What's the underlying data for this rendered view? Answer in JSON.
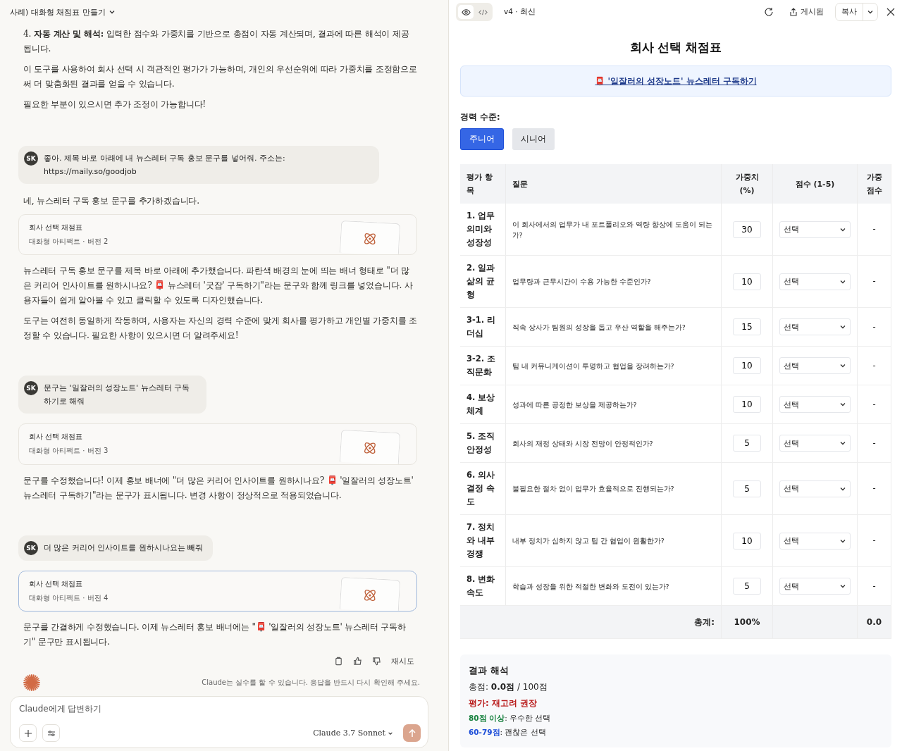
{
  "chat": {
    "title": "사례) 대화형 채점표 만들기",
    "messages": [
      {
        "kind": "assistant",
        "paragraphs": [
          "4. **자동 계산 및 해석:** 입력한 점수와 가중치를 기반으로 총점이 자동 계산되며, 결과에 따른 해석이 제공됩니다.",
          "이 도구를 사용하여 회사 선택 시 객관적인 평가가 가능하며, 개인의 우선순위에 따라 가중치를 조정함으로써 더 맞춤화된 결과를 얻을 수 있습니다.",
          "필요한 부분이 있으시면 추가 조정이 가능합니다!"
        ]
      },
      {
        "kind": "user",
        "avatar": "SK",
        "text": "좋아. 제목 바로 아래에 내 뉴스레터 구독 홍보 문구를 넣어줘. 주소는: https://maily.so/goodjob"
      },
      {
        "kind": "assistant",
        "paragraphs": [
          "네, 뉴스레터 구독 홍보 문구를 추가하겠습니다."
        ]
      },
      {
        "kind": "artifact",
        "title": "회사 선택 채점표",
        "subtitle": "대화형 아티팩트 · 버전 2",
        "selected": false
      },
      {
        "kind": "assistant",
        "paragraphs": [
          "뉴스레터 구독 홍보 문구를 제목 바로 아래에 추가했습니다. 파란색 배경의 눈에 띄는 배너 형태로 \"더 많은 커리어 인사이트를 원하시나요? 📮 뉴스레터 '굿잡' 구독하기\"라는 문구와 함께 링크를 넣었습니다. 사용자들이 쉽게 알아볼 수 있고 클릭할 수 있도록 디자인했습니다.",
          "도구는 여전히 동일하게 작동하며, 사용자는 자신의 경력 수준에 맞게 회사를 평가하고 개인별 가중치를 조정할 수 있습니다. 필요한 사항이 있으시면 더 알려주세요!"
        ]
      },
      {
        "kind": "user",
        "avatar": "SK",
        "text": "문구는 '일잘러의 성장노트' 뉴스레터 구독하기로 해줘"
      },
      {
        "kind": "artifact",
        "title": "회사 선택 채점표",
        "subtitle": "대화형 아티팩트 · 버전 3",
        "selected": false
      },
      {
        "kind": "assistant",
        "paragraphs": [
          "문구를 수정했습니다! 이제 홍보 배너에 \"더 많은 커리어 인사이트를 원하시나요? 📮 '일잘러의 성장노트' 뉴스레터 구독하기\"라는 문구가 표시됩니다. 변경 사항이 정상적으로 적용되었습니다."
        ]
      },
      {
        "kind": "user",
        "avatar": "SK",
        "text": "더 많은 커리어 인사이트를 원하시나요는 빼줘"
      },
      {
        "kind": "artifact",
        "title": "회사 선택 채점표",
        "subtitle": "대화형 아티팩트 · 버전 4",
        "selected": true
      },
      {
        "kind": "assistant",
        "paragraphs": [
          "문구를 간결하게 수정했습니다. 이제 뉴스레터 홍보 배너에는 \"📮 '일잘러의 성장노트' 뉴스레터 구독하기\" 문구만 표시됩니다."
        ]
      }
    ],
    "retry": "재시도",
    "disclaimer": "Claude는 실수를 할 수 있습니다. 응답을 반드시 다시 확인해 주세요.",
    "composer": {
      "placeholder": "Claude에게 답변하기",
      "model": "Claude 3.7 Sonnet"
    }
  },
  "artifact": {
    "version": "v4 · 최신",
    "published": "게시됨",
    "copy": "복사",
    "title": "회사 선택 채점표",
    "banner": "📮 '일잘러의 성장노트' 뉴스레터 구독하기",
    "level_label": "경력 수준:",
    "levels": [
      {
        "label": "주니어",
        "selected": true
      },
      {
        "label": "시니어",
        "selected": false
      }
    ],
    "columns": [
      "평가 항목",
      "질문",
      "가중치 (%)",
      "점수 (1-5)",
      "가중 점수"
    ],
    "rows": [
      {
        "item": "1. 업무 의미와 성장성",
        "question": "이 회사에서의 업무가 내 포트폴리오와 역량 향상에 도움이 되는가?",
        "weight": "30",
        "score": "선택",
        "weighted": "-"
      },
      {
        "item": "2. 일과 삶의 균형",
        "question": "업무량과 근무시간이 수용 가능한 수준인가?",
        "weight": "10",
        "score": "선택",
        "weighted": "-"
      },
      {
        "item": "3-1. 리더십",
        "question": "직속 상사가 팀원의 성장을 돕고 우산 역할을 해주는가?",
        "weight": "15",
        "score": "선택",
        "weighted": "-"
      },
      {
        "item": "3-2. 조직문화",
        "question": "팀 내 커뮤니케이션이 투명하고 협업을 장려하는가?",
        "weight": "10",
        "score": "선택",
        "weighted": "-"
      },
      {
        "item": "4. 보상 체계",
        "question": "성과에 따른 공정한 보상을 제공하는가?",
        "weight": "10",
        "score": "선택",
        "weighted": "-"
      },
      {
        "item": "5. 조직 안정성",
        "question": "회사의 재정 상태와 시장 전망이 안정적인가?",
        "weight": "5",
        "score": "선택",
        "weighted": "-"
      },
      {
        "item": "6. 의사 결정 속도",
        "question": "불필요한 절차 없이 업무가 효율적으로 진행되는가?",
        "weight": "5",
        "score": "선택",
        "weighted": "-"
      },
      {
        "item": "7. 정치와 내부 경쟁",
        "question": "내부 정치가 심하지 않고 팀 간 협업이 원활한가?",
        "weight": "10",
        "score": "선택",
        "weighted": "-"
      },
      {
        "item": "8. 변화 속도",
        "question": "학습과 성장을 위한 적절한 변화와 도전이 있는가?",
        "weight": "5",
        "score": "선택",
        "weighted": "-"
      }
    ],
    "total": {
      "label": "총계:",
      "weight": "100%",
      "weighted": "0.0"
    },
    "result": {
      "title": "결과 해석",
      "score": "총점: **0.0점** / 100점",
      "verdict": "평가: 재고려 권장",
      "legend": [
        {
          "range": "80점 이상",
          "text": ": 우수한 선택",
          "color": "#15803d"
        },
        {
          "range": "60-79점",
          "text": ": 괜찮은 선택",
          "color": "#1d4ed8"
        }
      ]
    }
  }
}
